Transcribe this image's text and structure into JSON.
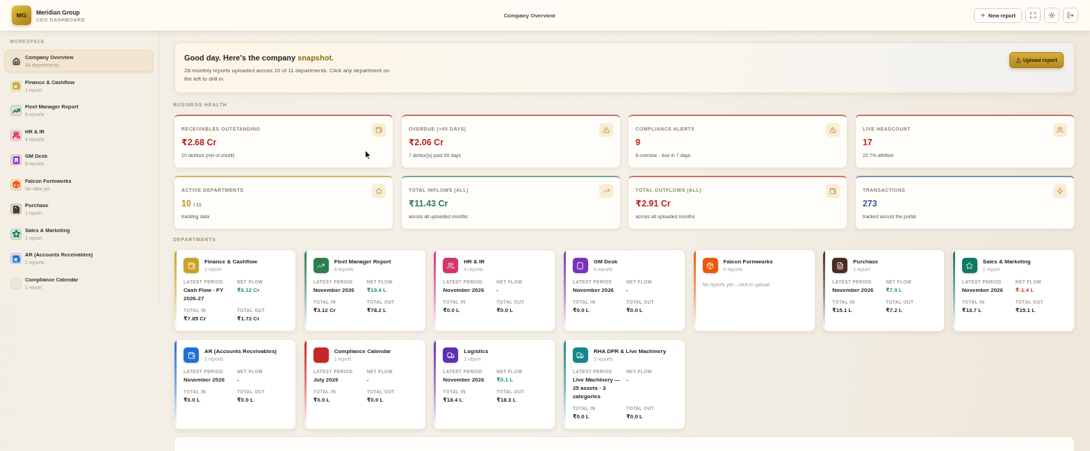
{
  "header": {
    "brand": {
      "initials": "MG",
      "name": "Meridian Group",
      "tagline": "CEO DASHBOARD"
    },
    "title": "Company Overview",
    "new_report_button": "New report"
  },
  "sidebar": {
    "section_label": "WORKSPACE",
    "items": [
      {
        "title": "Company Overview",
        "subtitle": "All departments",
        "selected": true
      },
      {
        "title": "Finance & Cashflow",
        "subtitle": "1 report",
        "selected": false,
        "color": "#c9a227"
      },
      {
        "title": "Fleet Manager Report",
        "subtitle": "8 reports",
        "selected": false,
        "color": "#2e7d4f"
      },
      {
        "title": "HR & IR",
        "subtitle": "4 reports",
        "selected": false,
        "color": "#d6336c"
      },
      {
        "title": "GM Desk",
        "subtitle": "6 reports",
        "selected": false,
        "color": "#7b2fbe"
      },
      {
        "title": "Falcon Formworks",
        "subtitle": "No data yet",
        "selected": false,
        "color": "#e8590c"
      },
      {
        "title": "Purchase",
        "subtitle": "1 report",
        "selected": false,
        "color": "#4a2c24"
      },
      {
        "title": "Sales & Marketing",
        "subtitle": "1 report",
        "selected": false,
        "color": "#0f7a63"
      },
      {
        "title": "AR (Accounts Receivables)",
        "subtitle": "2 reports",
        "selected": false,
        "color": "#1f6fd6"
      },
      {
        "title": "Compliance Calendar",
        "subtitle": "1 report",
        "selected": false
      }
    ]
  },
  "banner": {
    "title": "Good day. Here's the company",
    "highlight": "snapshot.",
    "text": "28 monthly reports uploaded across 10 of 11 departments. Click any department on the left to drill in.",
    "button": "Upload report"
  },
  "business_health": {
    "label": "BUSINESS HEALTH",
    "kpis": [
      {
        "label": "RECEIVABLES OUTSTANDING",
        "value": "₹2.68 Cr",
        "note": "10 debtors (net of credit)",
        "color": "#b3261e"
      },
      {
        "label": "OVERDUE (>90 DAYS)",
        "value": "₹2.06 Cr",
        "note": "7 debtor(s) past 90 days",
        "color": "#b3261e"
      },
      {
        "label": "COMPLIANCE ALERTS",
        "value": "9",
        "note": "6 overdue · due in 7 days",
        "color": "#b3261e"
      },
      {
        "label": "LIVE HEADCOUNT",
        "value": "17",
        "note": "22.7% attrition",
        "color": "#b3261e"
      },
      {
        "label": "ACTIVE DEPARTMENTS",
        "value": "10",
        "value_suffix": "/ 11",
        "note": "tracking data",
        "color": "#b8901c"
      },
      {
        "label": "TOTAL INFLOWS (ALL)",
        "value": "₹11.43 Cr",
        "note": "across all uploaded months",
        "color": "#2e7d4f"
      },
      {
        "label": "TOTAL OUTFLOWS (ALL)",
        "value": "₹2.91 Cr",
        "note": "across all uploaded months",
        "color": "#b3261e"
      },
      {
        "label": "TRANSACTIONS",
        "value": "273",
        "note": "tracked across the portal",
        "color": "#2f5d9a"
      }
    ]
  },
  "departments": {
    "label": "DEPARTMENTS",
    "items": [
      {
        "kind": "stats",
        "name": "Finance & Cashflow",
        "reports": "1 report",
        "color": "#c9a227",
        "stats": [
          {
            "label": "LATEST PERIOD",
            "value": "Cash Flow · FY 2026-27"
          },
          {
            "label": "NET FLOW",
            "value": "₹6.12 Cr",
            "color": "#1f8a5a"
          },
          {
            "label": "TOTAL IN",
            "value": "₹7.85 Cr"
          },
          {
            "label": "TOTAL OUT",
            "value": "₹1.72 Cr"
          }
        ]
      },
      {
        "kind": "stats",
        "name": "Fleet Manager Report",
        "reports": "8 reports",
        "color": "#2e7d4f",
        "stats": [
          {
            "label": "LATEST PERIOD",
            "value": "November 2026"
          },
          {
            "label": "NET FLOW",
            "value": "₹19.4 L",
            "color": "#1f8a5a"
          },
          {
            "label": "TOTAL IN",
            "value": "₹3.12 Cr"
          },
          {
            "label": "TOTAL OUT",
            "value": "₹78.2 L"
          }
        ]
      },
      {
        "kind": "stats",
        "name": "HR & IR",
        "reports": "4 reports",
        "color": "#d6336c",
        "stats": [
          {
            "label": "LATEST PERIOD",
            "value": "November 2026"
          },
          {
            "label": "NET FLOW",
            "value": "-"
          },
          {
            "label": "TOTAL IN",
            "value": "₹0.0 L"
          },
          {
            "label": "TOTAL OUT",
            "value": "₹0.0 L"
          }
        ]
      },
      {
        "kind": "stats",
        "name": "GM Desk",
        "reports": "6 reports",
        "color": "#7b2fbe",
        "stats": [
          {
            "label": "LATEST PERIOD",
            "value": "November 2026"
          },
          {
            "label": "NET FLOW",
            "value": "-"
          },
          {
            "label": "TOTAL IN",
            "value": "₹0.0 L"
          },
          {
            "label": "TOTAL OUT",
            "value": "₹0.0 L"
          }
        ]
      },
      {
        "kind": "empty",
        "name": "Falcon Formworks",
        "reports": "0 reports",
        "color": "#e8590c",
        "message": "No reports yet – click to upload"
      },
      {
        "kind": "stats",
        "name": "Purchase",
        "reports": "1 report",
        "color": "#4a2c24",
        "stats": [
          {
            "label": "LATEST PERIOD",
            "value": "November 2026"
          },
          {
            "label": "NET FLOW",
            "value": "₹7.9 L",
            "color": "#1f8a5a"
          },
          {
            "label": "TOTAL IN",
            "value": "₹15.1 L"
          },
          {
            "label": "TOTAL OUT",
            "value": "₹7.2 L"
          }
        ]
      },
      {
        "kind": "stats",
        "name": "Sales & Marketing",
        "reports": "1 report",
        "color": "#0f7a63",
        "stats": [
          {
            "label": "LATEST PERIOD",
            "value": "November 2026"
          },
          {
            "label": "NET FLOW",
            "value": "₹-1.4 L",
            "color": "#c0392b"
          },
          {
            "label": "TOTAL IN",
            "value": "₹13.7 L"
          },
          {
            "label": "TOTAL OUT",
            "value": "₹15.1 L"
          }
        ]
      },
      {
        "kind": "stats",
        "name": "AR (Accounts Receivables)",
        "reports": "2 reports",
        "color": "#1f6fd6",
        "stats": [
          {
            "label": "LATEST PERIOD",
            "value": "November 2026"
          },
          {
            "label": "NET FLOW",
            "value": "-"
          },
          {
            "label": "TOTAL IN",
            "value": "₹0.0 L"
          },
          {
            "label": "TOTAL OUT",
            "value": "₹0.0 L"
          }
        ]
      },
      {
        "kind": "stats",
        "name": "Compliance Calendar",
        "reports": "1 report",
        "color": "#c62828",
        "stats": [
          {
            "label": "LATEST PERIOD",
            "value": "July 2026"
          },
          {
            "label": "NET FLOW",
            "value": "-"
          },
          {
            "label": "TOTAL IN",
            "value": "₹0.0 L"
          },
          {
            "label": "TOTAL OUT",
            "value": "₹0.0 L"
          }
        ]
      },
      {
        "kind": "stats",
        "name": "Logistics",
        "reports": "1 report",
        "color": "#5b30b5",
        "stats": [
          {
            "label": "LATEST PERIOD",
            "value": "November 2026"
          },
          {
            "label": "NET FLOW",
            "value": "₹0.1 L",
            "color": "#1f8a5a"
          },
          {
            "label": "TOTAL IN",
            "value": "₹18.4 L"
          },
          {
            "label": "TOTAL OUT",
            "value": "₹18.3 L"
          }
        ]
      },
      {
        "kind": "stats",
        "name": "RHA DPR & Live Machinery",
        "reports": "3 reports",
        "color": "#11898a",
        "stats": [
          {
            "label": "LATEST PERIOD",
            "value": "Live Machinery — 25 assets · 3 categories"
          },
          {
            "label": "NET FLOW",
            "value": "-"
          },
          {
            "label": "TOTAL IN",
            "value": "₹0.0 L"
          },
          {
            "label": "TOTAL OUT",
            "value": "₹0.0 L"
          }
        ]
      }
    ]
  }
}
